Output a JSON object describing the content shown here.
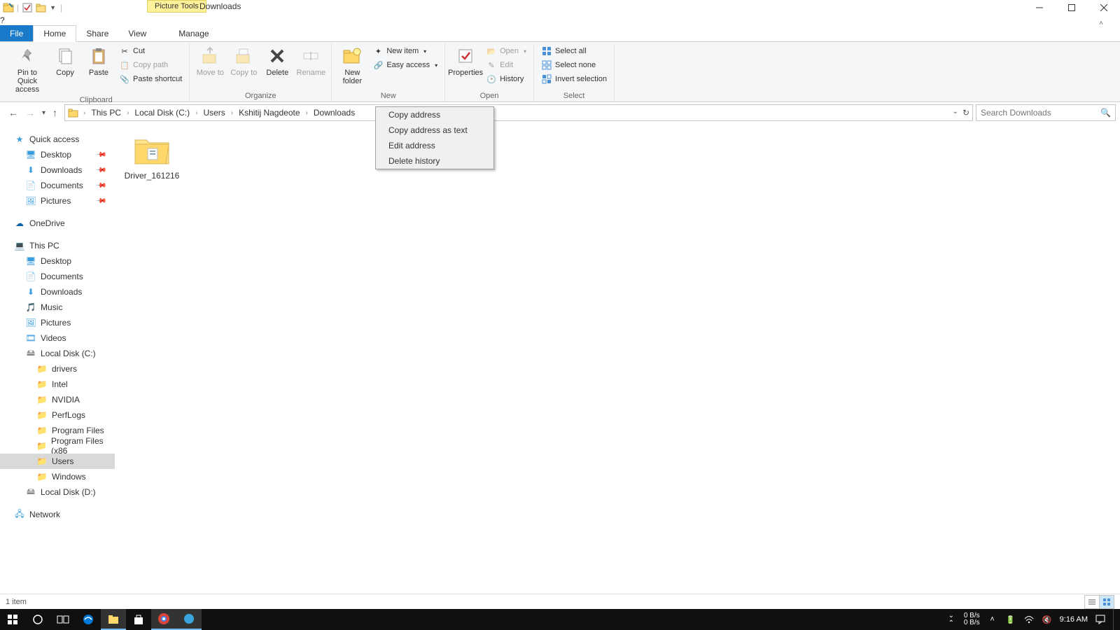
{
  "titlebar": {
    "tools_tab": "Picture Tools",
    "title": "Downloads"
  },
  "ribbon_tabs": {
    "file": "File",
    "home": "Home",
    "share": "Share",
    "view": "View",
    "manage": "Manage"
  },
  "ribbon": {
    "clipboard": {
      "pin": "Pin to Quick access",
      "copy": "Copy",
      "paste": "Paste",
      "cut": "Cut",
      "copy_path": "Copy path",
      "paste_shortcut": "Paste shortcut",
      "label": "Clipboard"
    },
    "organize": {
      "move_to": "Move to",
      "copy_to": "Copy to",
      "delete": "Delete",
      "rename": "Rename",
      "label": "Organize"
    },
    "new": {
      "new_folder": "New folder",
      "new_item": "New item",
      "easy_access": "Easy access",
      "label": "New"
    },
    "open": {
      "properties": "Properties",
      "open": "Open",
      "edit": "Edit",
      "history": "History",
      "label": "Open"
    },
    "select": {
      "select_all": "Select all",
      "select_none": "Select none",
      "invert": "Invert selection",
      "label": "Select"
    }
  },
  "breadcrumb": [
    "This PC",
    "Local Disk (C:)",
    "Users",
    "Kshitij Nagdeote",
    "Downloads"
  ],
  "search": {
    "placeholder": "Search Downloads"
  },
  "context_menu": [
    "Copy address",
    "Copy address as text",
    "Edit address",
    "Delete history"
  ],
  "nav_tree": {
    "quick_access": "Quick access",
    "qa_items": [
      "Desktop",
      "Downloads",
      "Documents",
      "Pictures"
    ],
    "onedrive": "OneDrive",
    "this_pc": "This PC",
    "pc_items": [
      "Desktop",
      "Documents",
      "Downloads",
      "Music",
      "Pictures",
      "Videos",
      "Local Disk (C:)"
    ],
    "c_items": [
      "drivers",
      "Intel",
      "NVIDIA",
      "PerfLogs",
      "Program Files",
      "Program Files (x86",
      "Users",
      "Windows"
    ],
    "local_d": "Local Disk (D:)",
    "network": "Network"
  },
  "content": {
    "items": [
      {
        "name": "Driver_161216"
      }
    ]
  },
  "statusbar": {
    "count": "1 item"
  },
  "taskbar": {
    "net_down": "0 B/s",
    "net_up": "0 B/s",
    "clock": "9:16 AM"
  }
}
